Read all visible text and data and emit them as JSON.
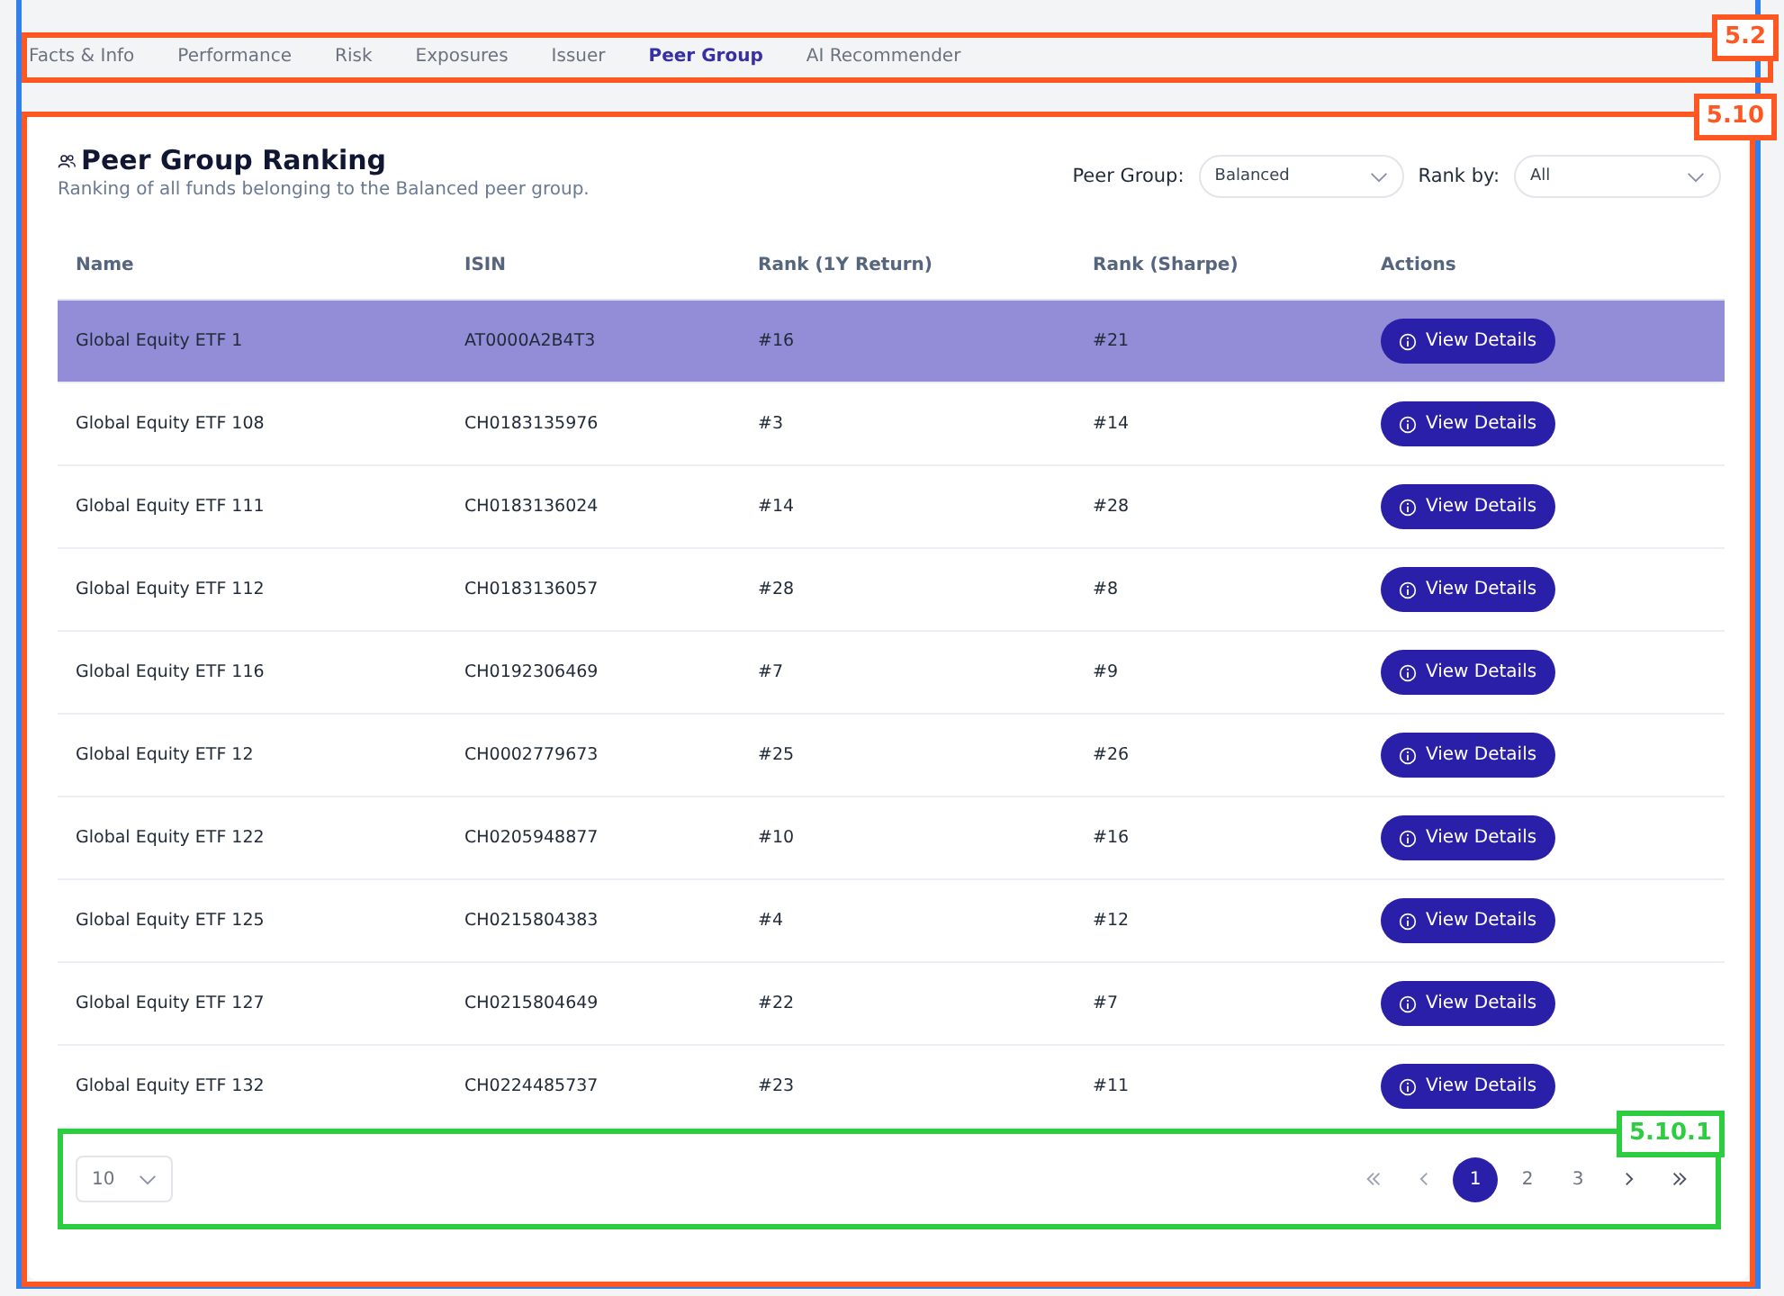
{
  "tabs": [
    {
      "label": "Facts & Info",
      "selected": false
    },
    {
      "label": "Performance",
      "selected": false
    },
    {
      "label": "Risk",
      "selected": false
    },
    {
      "label": "Exposures",
      "selected": false
    },
    {
      "label": "Issuer",
      "selected": false
    },
    {
      "label": "Peer Group",
      "selected": true
    },
    {
      "label": "AI Recommender",
      "selected": false
    }
  ],
  "tabs_annotation": {
    "label": "5.2",
    "color": "#ff5722"
  },
  "panel_annotation": {
    "label": "5.10",
    "color": "#ff5722"
  },
  "panel": {
    "title": "Peer Group Ranking",
    "subtitle": "Ranking of all funds belonging to the Balanced peer group.",
    "filters": [
      {
        "label": "Peer Group:",
        "value": "Balanced"
      },
      {
        "label": "Rank by:",
        "value": "All"
      }
    ]
  },
  "table": {
    "columns": [
      "Name",
      "ISIN",
      "Rank (1Y Return)",
      "Rank (Sharpe)",
      "Actions"
    ],
    "rows": [
      {
        "name": "Global Equity ETF 1",
        "isin": "AT0000A2B4T3",
        "rank_return": "#16",
        "rank_sharpe": "#21",
        "action": "View Details",
        "selected": true
      },
      {
        "name": "Global Equity ETF 108",
        "isin": "CH0183135976",
        "rank_return": "#3",
        "rank_sharpe": "#14",
        "action": "View Details",
        "selected": false
      },
      {
        "name": "Global Equity ETF 111",
        "isin": "CH0183136024",
        "rank_return": "#14",
        "rank_sharpe": "#28",
        "action": "View Details",
        "selected": false
      },
      {
        "name": "Global Equity ETF 112",
        "isin": "CH0183136057",
        "rank_return": "#28",
        "rank_sharpe": "#8",
        "action": "View Details",
        "selected": false
      },
      {
        "name": "Global Equity ETF 116",
        "isin": "CH0192306469",
        "rank_return": "#7",
        "rank_sharpe": "#9",
        "action": "View Details",
        "selected": false
      },
      {
        "name": "Global Equity ETF 12",
        "isin": "CH0002779673",
        "rank_return": "#25",
        "rank_sharpe": "#26",
        "action": "View Details",
        "selected": false
      },
      {
        "name": "Global Equity ETF 122",
        "isin": "CH0205948877",
        "rank_return": "#10",
        "rank_sharpe": "#16",
        "action": "View Details",
        "selected": false
      },
      {
        "name": "Global Equity ETF 125",
        "isin": "CH0215804383",
        "rank_return": "#4",
        "rank_sharpe": "#12",
        "action": "View Details",
        "selected": false
      },
      {
        "name": "Global Equity ETF 127",
        "isin": "CH0215804649",
        "rank_return": "#22",
        "rank_sharpe": "#7",
        "action": "View Details",
        "selected": false
      },
      {
        "name": "Global Equity ETF 132",
        "isin": "CH0224485737",
        "rank_return": "#23",
        "rank_sharpe": "#11",
        "action": "View Details",
        "selected": false
      }
    ]
  },
  "pagination": {
    "page_size": "10",
    "pages": [
      {
        "label": "1",
        "selected": true
      },
      {
        "label": "2",
        "selected": false
      },
      {
        "label": "3",
        "selected": false
      }
    ]
  },
  "pagination_annotation": {
    "label": "5.10.1",
    "color": "#2ecc40"
  }
}
